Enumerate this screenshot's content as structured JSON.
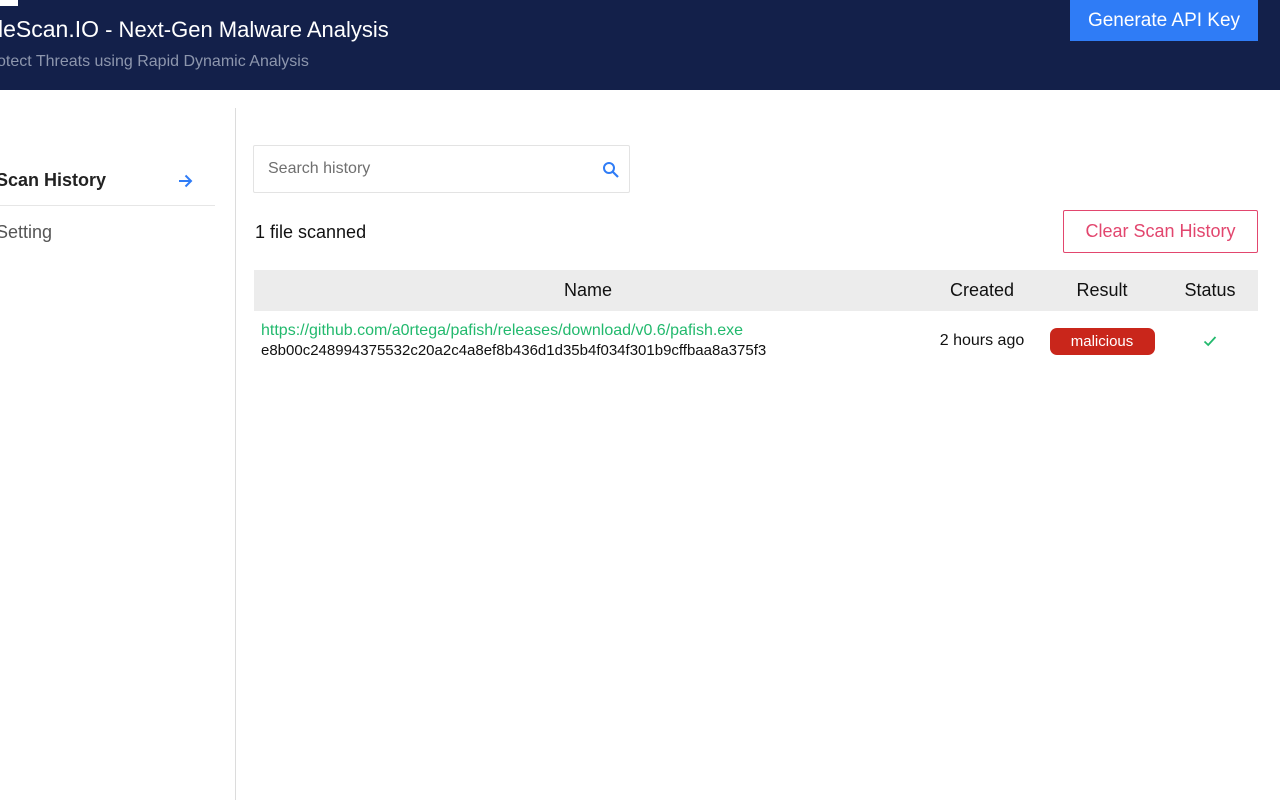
{
  "header": {
    "brand": "leScan.IO",
    "title_rest": " - Next-Gen Malware Analysis",
    "subtitle": "otect Threats using Rapid Dynamic Analysis",
    "api_button_label": "Generate API Key",
    "background_color": "#13204a",
    "accent_color": "#2f7cf6"
  },
  "sidebar": {
    "items": [
      {
        "label": "Scan History",
        "active": true,
        "icon": "arrow-right-icon"
      },
      {
        "label": "Setting",
        "active": false
      }
    ]
  },
  "search": {
    "placeholder": "Search history",
    "value": "",
    "icon": "search-icon"
  },
  "summary": {
    "file_count_text": "1 file scanned",
    "clear_button_label": "Clear Scan History"
  },
  "table": {
    "headers": {
      "name": "Name",
      "created": "Created",
      "result": "Result",
      "status": "Status"
    },
    "rows": [
      {
        "url": "https://github.com/a0rtega/pafish/releases/download/v0.6/pafish.exe",
        "hash": "e8b00c248994375532c20a2c4a8ef8b436d1d35b4f034f301b9cffbaa8a375f3",
        "created": "2 hours ago",
        "result": "malicious",
        "result_color": "#c9261b",
        "status_icon": "checkmark-icon"
      }
    ]
  }
}
